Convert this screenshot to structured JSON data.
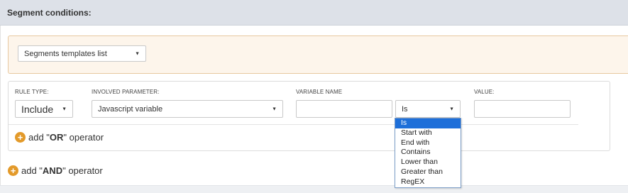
{
  "header": {
    "title": "Segment conditions:"
  },
  "templates": {
    "selected": "Segments templates list"
  },
  "rule": {
    "labels": {
      "rule_type": "RULE TYPE:",
      "involved_parameter": "INVOLVED PARAMETER:",
      "variable_name": "VARIABLE NAME",
      "value": "VALUE:"
    },
    "rule_type_value": "Include",
    "parameter_value": "Javascript variable",
    "variable_name_value": "",
    "operator_value": "Is",
    "value_value": "",
    "operator_options": [
      "Is",
      "Start with",
      "End with",
      "Contains",
      "Lower than",
      "Greater than",
      "RegEX"
    ],
    "operator_selected_index": 0
  },
  "add_or": {
    "prefix": "add \"",
    "keyword": "OR",
    "suffix": "\" operator"
  },
  "add_and": {
    "prefix": "add \"",
    "keyword": "AND",
    "suffix": "\" operator"
  },
  "colors": {
    "header_bg": "#dde1e8",
    "templates_bg": "#fdf5eb",
    "templates_border": "#e8c9a0",
    "plus_icon": "#e39a2a",
    "selected_option": "#1e6fd9"
  },
  "icons": {
    "dropdown_arrow": "chevron-down-icon",
    "add": "plus-circle-icon"
  }
}
